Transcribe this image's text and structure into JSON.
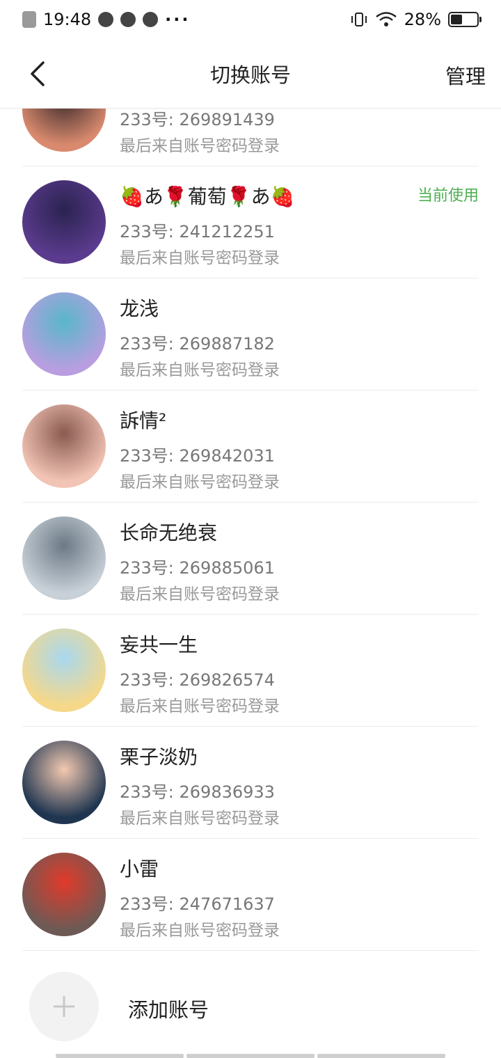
{
  "status_bar": {
    "time": "19:48",
    "dots": "···",
    "battery": "28%",
    "battery_level": 0.28,
    "icons": [
      "close-notif-icon",
      "q-app-icon",
      "vpn-icon",
      "play-app-icon",
      "vibrate-icon",
      "wifi-icon",
      "battery-icon"
    ]
  },
  "nav": {
    "title": "切换账号",
    "manage": "管理",
    "back_icon": "chevron-left-icon"
  },
  "accounts": [
    {
      "name": "",
      "id": "233号: 269891439",
      "login": "最后来自账号密码登录",
      "current": "",
      "colors": [
        "#d98a6e",
        "#3b2a2a"
      ]
    },
    {
      "name": "🍓あ🌹葡萄🌹あ🍓",
      "id": "233号: 241212251",
      "login": "最后来自账号密码登录",
      "current": "当前使用",
      "colors": [
        "#5b3b8e",
        "#2a2350"
      ]
    },
    {
      "name": "龙浅",
      "id": "233号: 269887182",
      "login": "最后来自账号密码登录",
      "current": "",
      "colors": [
        "#b89ee0",
        "#58b7c9"
      ]
    },
    {
      "name": "訴情²",
      "id": "233号: 269842031",
      "login": "最后来自账号密码登录",
      "current": "",
      "colors": [
        "#f2c4b5",
        "#8a5a50"
      ]
    },
    {
      "name": "长命无绝衰",
      "id": "233号: 269885061",
      "login": "最后来自账号密码登录",
      "current": "",
      "colors": [
        "#c8d0d8",
        "#6c7a86"
      ]
    },
    {
      "name": "妄共一生",
      "id": "233号: 269826574",
      "login": "最后来自账号密码登录",
      "current": "",
      "colors": [
        "#f5d88a",
        "#a8d8f0"
      ]
    },
    {
      "name": "栗子淡奶",
      "id": "233号: 269836933",
      "login": "最后来自账号密码登录",
      "current": "",
      "colors": [
        "#1f3550",
        "#f3c9b0"
      ]
    },
    {
      "name": "小雷",
      "id": "233号: 247671637",
      "login": "最后来自账号密码登录",
      "current": "",
      "colors": [
        "#6e5a55",
        "#e03a2a"
      ]
    }
  ],
  "add_account": {
    "label": "添加账号",
    "icon": "plus-icon"
  }
}
